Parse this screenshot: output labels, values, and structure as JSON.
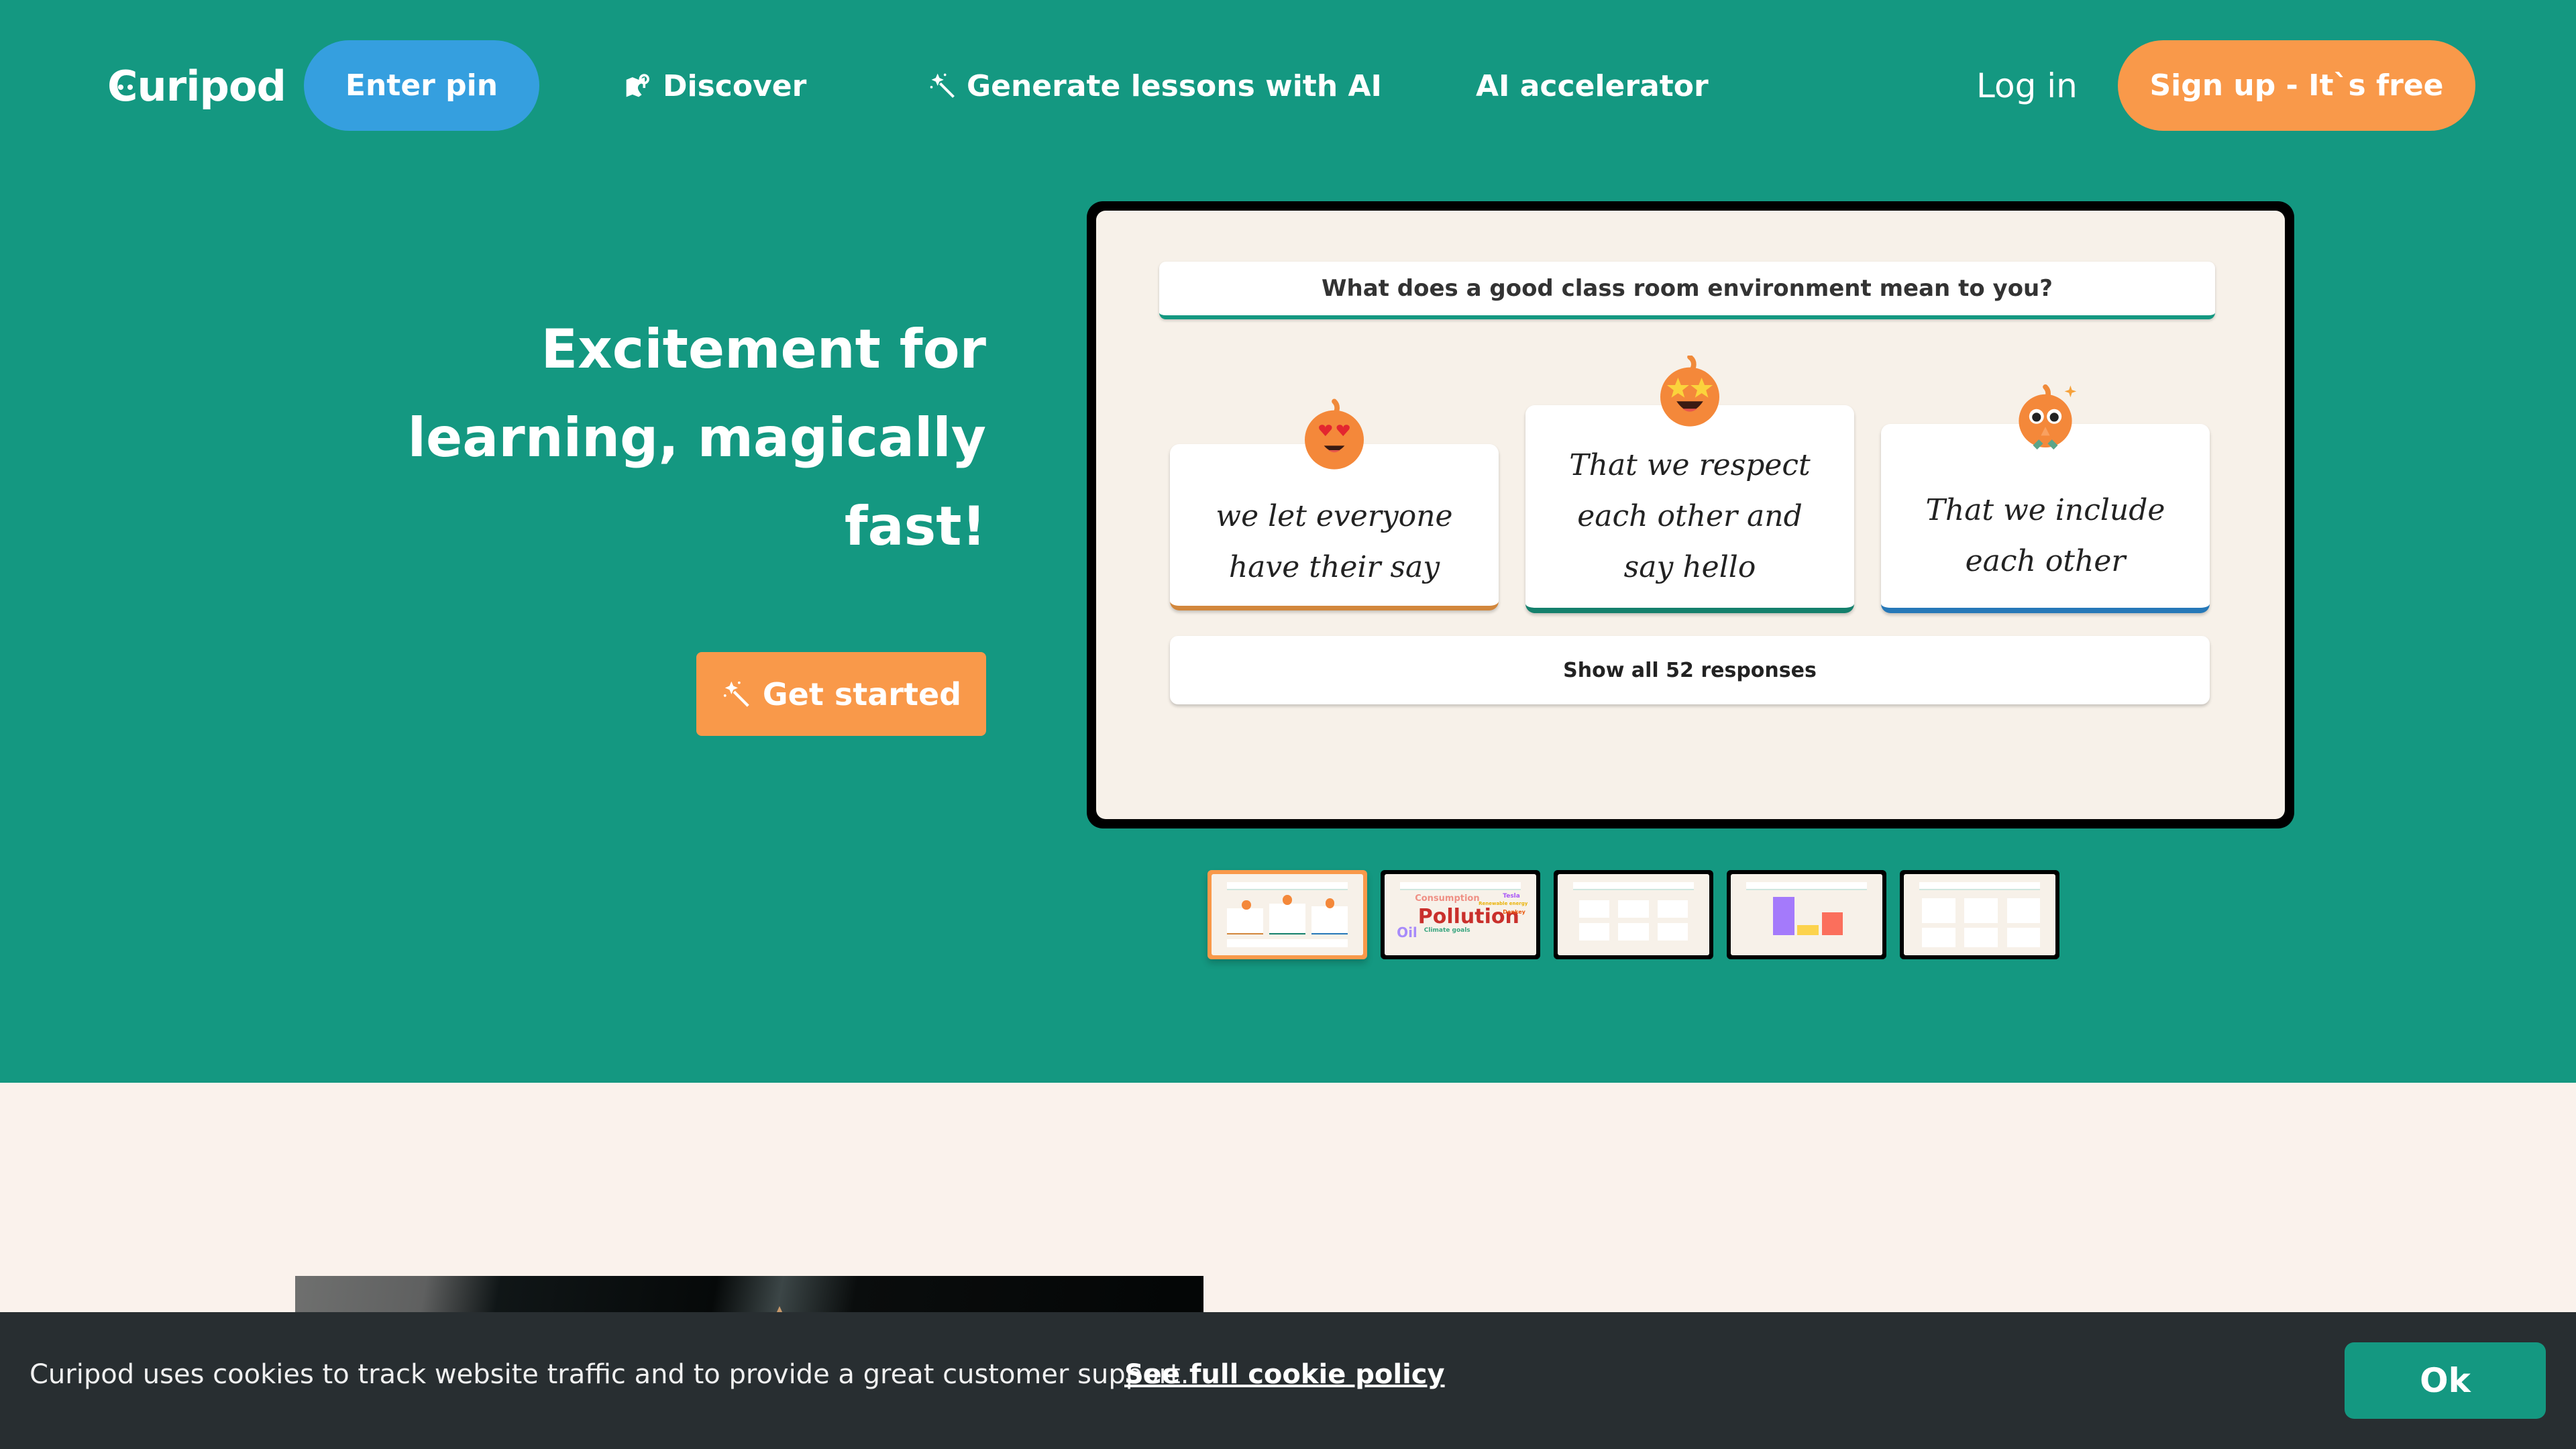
{
  "brand": {
    "logo_text": "Curipod",
    "primary_color": "#149881",
    "accent_color": "#f9994a",
    "pin_color": "#359fdf"
  },
  "nav": {
    "enter_pin": "Enter pin",
    "links": [
      {
        "label": "Discover",
        "icon": "map-pin-icon"
      },
      {
        "label": "Generate lessons with AI",
        "icon": "magic-wand-icon"
      },
      {
        "label": "AI accelerator"
      }
    ],
    "login": "Log in",
    "signup": "Sign up - It`s free"
  },
  "hero": {
    "headline_lines": [
      "Excitement for",
      "learning, magically",
      "fast!"
    ],
    "cta": "Get started",
    "cta_icon": "magic-wand-icon"
  },
  "slide": {
    "question": "What does a good class room environment mean to you?",
    "responses": [
      {
        "text_lines": [
          "we let everyone",
          "have their say"
        ],
        "emoji": "heart-eyes-mascot",
        "accent": "#d2873c"
      },
      {
        "text_lines": [
          "That we respect",
          "each other and",
          "say hello"
        ],
        "emoji": "star-eyes-mascot",
        "accent": "#14806c"
      },
      {
        "text_lines": [
          "That we include",
          "each other"
        ],
        "emoji": "pleading-mascot",
        "accent": "#2678b8"
      }
    ],
    "show_all": "Show all 52 responses"
  },
  "thumbnails": [
    {
      "type": "responses",
      "active": true
    },
    {
      "type": "word-cloud",
      "active": false,
      "words": [
        "Pollution",
        "Consumption",
        "Oil",
        "Climate goals",
        "Tesla",
        "Renewable energy",
        "Donkey"
      ]
    },
    {
      "type": "drawings",
      "active": false
    },
    {
      "type": "bar-chart",
      "active": false,
      "bar_values": [
        0.85,
        0.22,
        0.5
      ]
    },
    {
      "type": "text-cards",
      "active": false
    }
  ],
  "cookie": {
    "message": "Curipod uses cookies to track website traffic and to provide a great customer support.",
    "link": "See full cookie policy",
    "ok": "Ok"
  }
}
